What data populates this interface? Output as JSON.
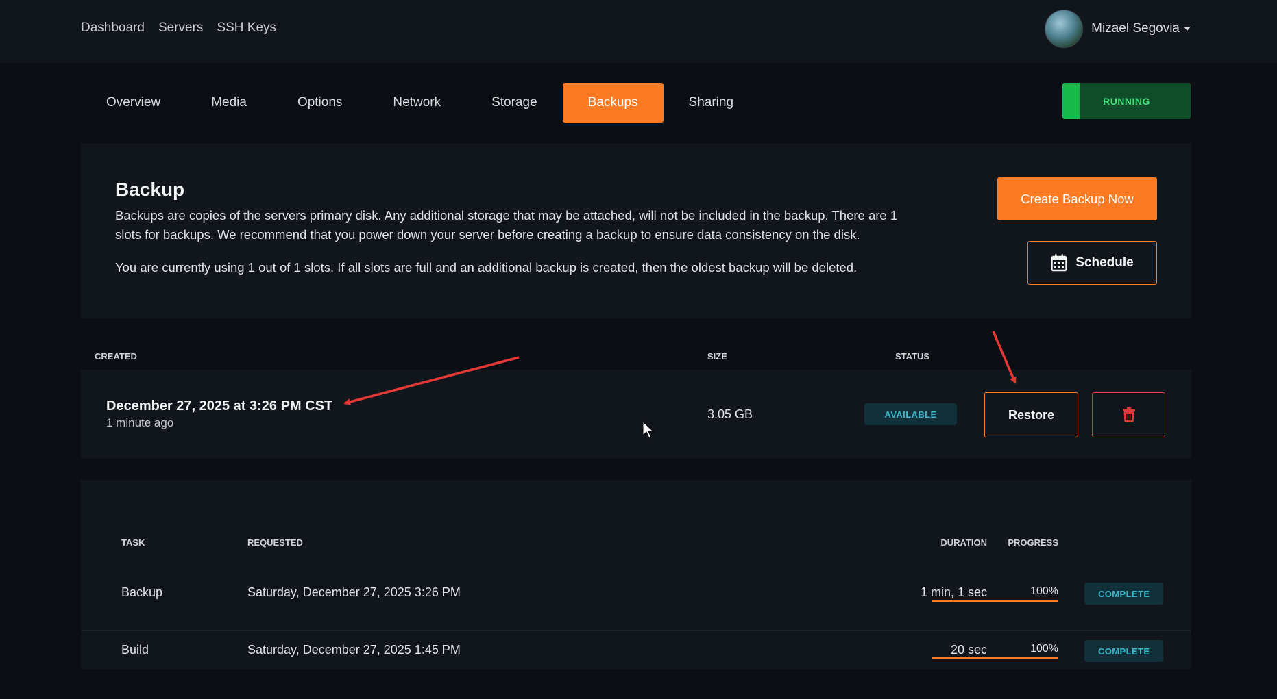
{
  "topnav": {
    "items": [
      "Dashboard",
      "Servers",
      "SSH Keys"
    ],
    "user_name": "Mizael Segovia"
  },
  "tabs": [
    "Overview",
    "Media",
    "Options",
    "Network",
    "Storage",
    "Backups",
    "Sharing"
  ],
  "active_tab": "Backups",
  "server_status": "RUNNING",
  "backup_info": {
    "title": "Backup",
    "description": "Backups are copies of the servers primary disk. Any additional storage that may be attached, will not be included in the backup. There are 1 slots for backups. We recommend that you power down your server before creating a backup to ensure data consistency on the disk.",
    "usage": "You are currently using 1 out of 1 slots. If all slots are full and an additional backup is created, then the oldest backup will be deleted.",
    "create_button": "Create Backup Now",
    "schedule_button": "Schedule"
  },
  "backups_table": {
    "headers": {
      "created": "CREATED",
      "size": "SIZE",
      "status": "STATUS"
    },
    "rows": [
      {
        "created": "December 27, 2025 at 3:26 PM CST",
        "ago": "1 minute ago",
        "size": "3.05 GB",
        "status": "AVAILABLE",
        "restore_label": "Restore"
      }
    ]
  },
  "tasks_table": {
    "headers": {
      "task": "TASK",
      "requested": "REQUESTED",
      "duration": "DURATION",
      "progress": "PROGRESS"
    },
    "rows": [
      {
        "task": "Backup",
        "requested": "Saturday, December 27, 2025 3:26 PM",
        "duration": "1 min, 1 sec",
        "progress": 1.0,
        "progress_label": "100%",
        "status": "COMPLETE"
      },
      {
        "task": "Build",
        "requested": "Saturday, December 27, 2025 1:45 PM",
        "duration": "20 sec",
        "progress": 1.0,
        "progress_label": "100%",
        "status": "COMPLETE"
      }
    ]
  },
  "colors": {
    "accent": "#fb7a22",
    "running": "#19b84a",
    "badge_text": "#3bb6c8",
    "delete": "#e03a3a",
    "annotation_arrow": "#e53935"
  }
}
